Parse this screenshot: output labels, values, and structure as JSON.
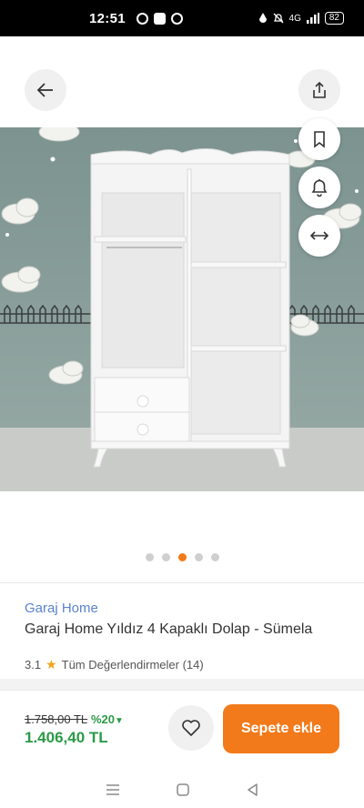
{
  "status": {
    "time": "12:51",
    "network": "4G",
    "battery": "82"
  },
  "icons": {
    "back": "arrow-left-icon",
    "share": "share-icon",
    "bookmark": "bookmark-icon",
    "bell": "bell-icon",
    "compare": "compare-arrows-icon",
    "heart": "heart-icon",
    "star": "star-icon"
  },
  "gallery": {
    "dot_count": 5,
    "active_index": 2
  },
  "product": {
    "brand": "Garaj Home",
    "title": "Garaj Home Yıldız 4 Kapaklı Dolap - Sümela",
    "rating": "3.1",
    "reviews_label": "Tüm Değerlendirmeler (14)"
  },
  "pricing": {
    "old_price": "1.758,00 TL",
    "discount": "%20",
    "new_price": "1.406,40 TL"
  },
  "actions": {
    "add_to_cart": "Sepete ekle"
  },
  "colors": {
    "accent": "#f27a1a",
    "price_green": "#2b9a47",
    "brand_link": "#5b83d0"
  }
}
